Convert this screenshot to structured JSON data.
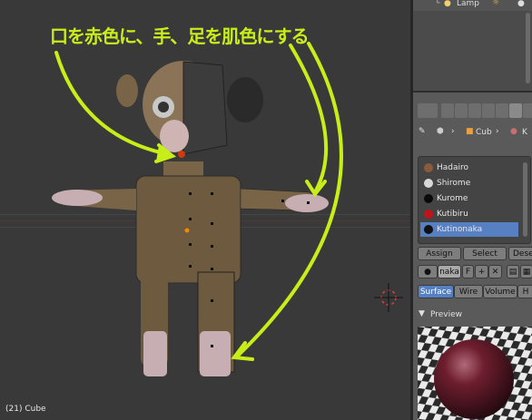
{
  "outliner": {
    "item_label": "Lamp"
  },
  "viewport": {
    "annotation": "口を赤色に、手、足を肌色にする",
    "status": "(21) Cube"
  },
  "properties": {
    "breadcrumb": {
      "object": "Cub",
      "material": "K"
    },
    "materials": [
      {
        "name": "Hadairo",
        "color": "#8a5a3c"
      },
      {
        "name": "Shirome",
        "color": "#d8d8d8"
      },
      {
        "name": "Kurome",
        "color": "#0a0a0a"
      },
      {
        "name": "Kutibiru",
        "color": "#c0141a"
      },
      {
        "name": "Kutinonaka",
        "color": "#111111",
        "selected": true
      }
    ],
    "assign_label": "Assign",
    "select_label": "Select",
    "deselect_label": "Dese",
    "material_name": "naka",
    "fake_user_label": "F",
    "tabs": {
      "surface": "Surface",
      "wire": "Wire",
      "volume": "Volume",
      "halo": "H"
    },
    "preview_label": "Preview"
  }
}
